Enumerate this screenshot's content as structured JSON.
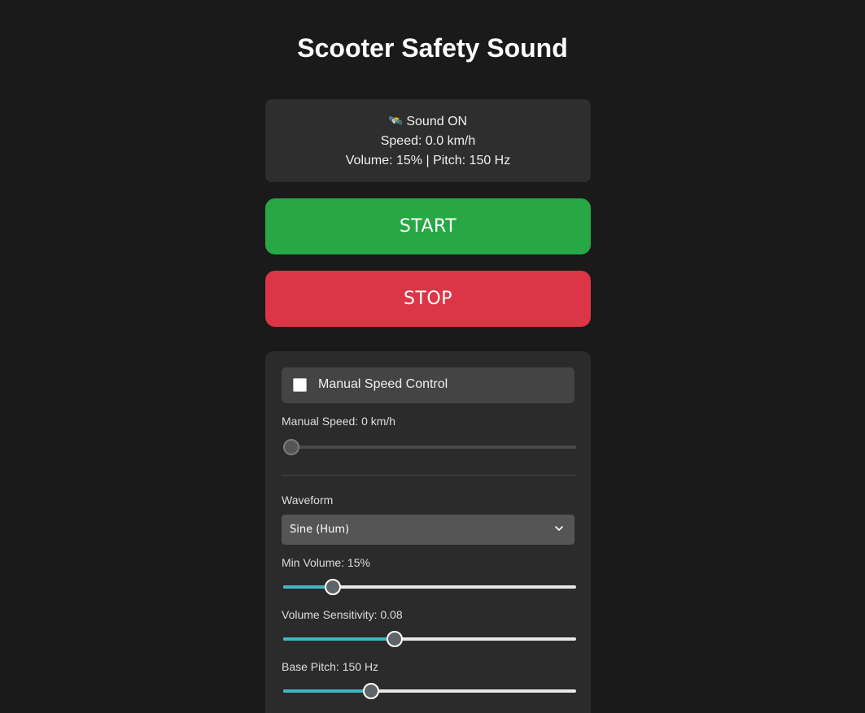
{
  "title": "Scooter Safety Sound",
  "status": {
    "icon": "satellite-icon",
    "icon_glyph": "🛰️",
    "sound": "Sound ON",
    "speed": "Speed: 0.0 km/h",
    "volume_pitch": "Volume: 15% | Pitch: 150 Hz"
  },
  "buttons": {
    "start": "START",
    "stop": "STOP",
    "start_color": "#28a745",
    "stop_color": "#dc3545"
  },
  "settings": {
    "manual_toggle": {
      "label": "Manual Speed Control",
      "checked": false
    },
    "manual_speed": {
      "label": "Manual Speed: 0 km/h",
      "fraction": 0.0,
      "disabled": true
    },
    "waveform": {
      "label": "Waveform",
      "selected": "Sine (Hum)"
    },
    "min_volume": {
      "label": "Min Volume: 15%",
      "fraction": 0.17
    },
    "volume_sensitivity": {
      "label": "Volume Sensitivity: 0.08",
      "fraction": 0.38
    },
    "base_pitch": {
      "label": "Base Pitch: 150 Hz",
      "fraction": 0.3
    }
  },
  "accent_color": "#3fb7c2"
}
